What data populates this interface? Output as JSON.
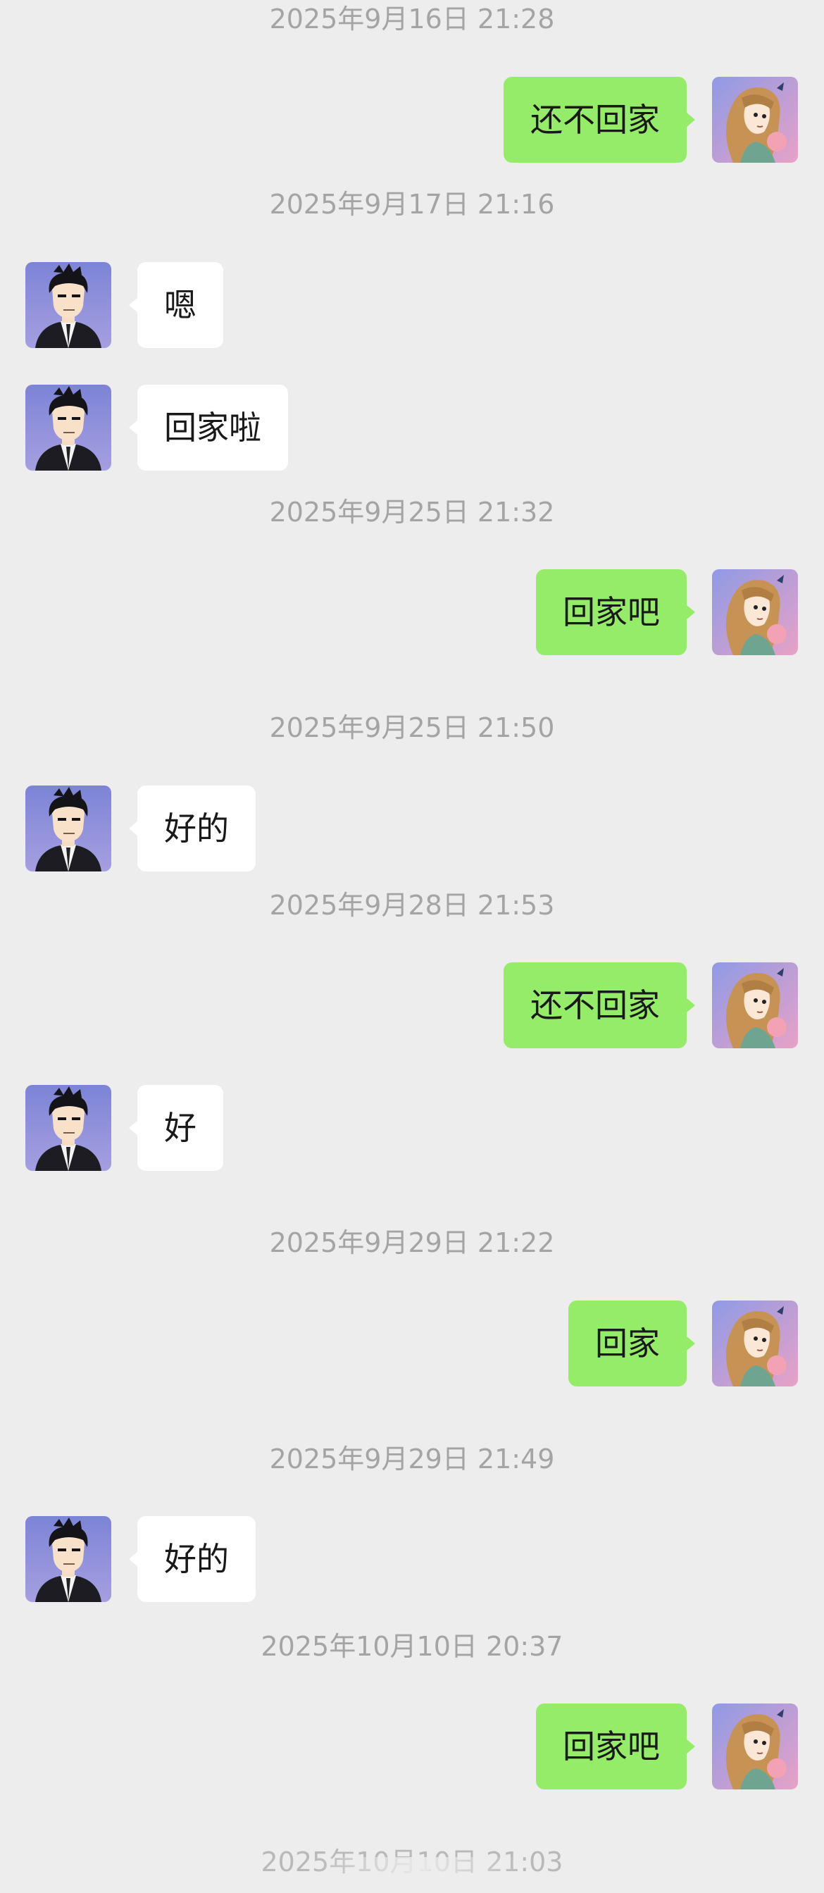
{
  "chat": {
    "entries": [
      {
        "type": "time",
        "text": "2025年9月16日 21:28"
      },
      {
        "type": "msg",
        "side": "out",
        "text": "还不回家"
      },
      {
        "type": "time",
        "text": "2025年9月17日 21:16"
      },
      {
        "type": "msg",
        "side": "in",
        "text": "嗯"
      },
      {
        "type": "msg",
        "side": "in",
        "text": "回家啦"
      },
      {
        "type": "time",
        "text": "2025年9月25日 21:32"
      },
      {
        "type": "msg",
        "side": "out",
        "text": "回家吧"
      },
      {
        "type": "time",
        "text": "2025年9月25日 21:50"
      },
      {
        "type": "msg",
        "side": "in",
        "text": "好的"
      },
      {
        "type": "time",
        "text": "2025年9月28日 21:53"
      },
      {
        "type": "msg",
        "side": "out",
        "text": "还不回家"
      },
      {
        "type": "msg",
        "side": "in",
        "text": "好"
      },
      {
        "type": "time",
        "text": "2025年9月29日 21:22"
      },
      {
        "type": "msg",
        "side": "out",
        "text": "回家"
      },
      {
        "type": "time",
        "text": "2025年9月29日 21:49"
      },
      {
        "type": "msg",
        "side": "in",
        "text": "好的"
      },
      {
        "type": "time",
        "text": "2025年10月10日 20:37"
      },
      {
        "type": "msg",
        "side": "out",
        "text": "回家吧"
      },
      {
        "type": "time",
        "text": "2025年10月10日 21:03"
      }
    ]
  },
  "colors": {
    "background": "#ededed",
    "outgoing_bubble": "#95ec69",
    "incoming_bubble": "#ffffff",
    "timestamp": "#a4a4a4"
  },
  "icons": {
    "incoming_avatar": "man-in-suit-avatar-icon",
    "outgoing_avatar": "woman-long-hair-avatar-icon"
  }
}
